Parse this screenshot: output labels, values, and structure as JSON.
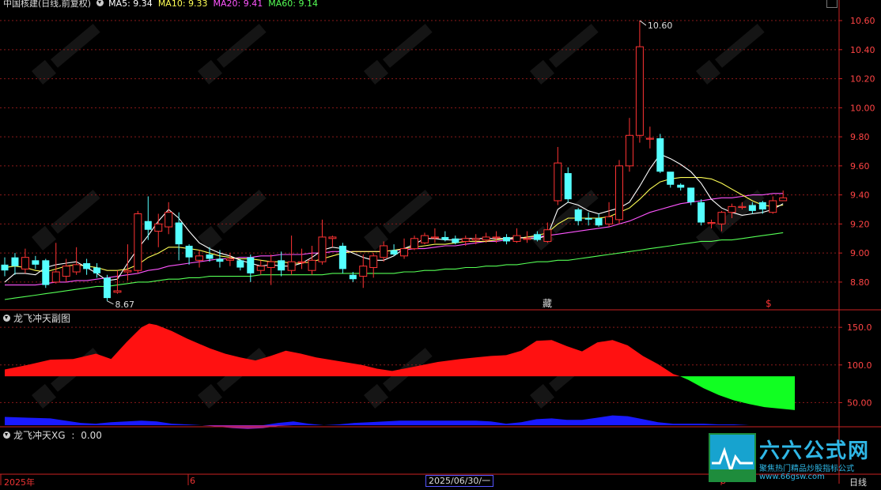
{
  "header": {
    "title": "中国核建(日线,前复权)",
    "ma": [
      {
        "label": "MA5: 9.34",
        "color": "#ffffff"
      },
      {
        "label": "MA10: 9.33",
        "color": "#ffff55"
      },
      {
        "label": "MA20: 9.41",
        "color": "#ff55ff"
      },
      {
        "label": "MA60: 9.14",
        "color": "#55ff55"
      }
    ]
  },
  "chart_data": [
    {
      "type": "candlestick",
      "yticks": [
        "10.60",
        "10.40",
        "10.20",
        "10.00",
        "9.80",
        "9.60",
        "9.40",
        "9.20",
        "9.00",
        "8.80"
      ],
      "ylim": [
        8.62,
        10.72
      ],
      "annotations": {
        "high_label": "10.60",
        "low_label": "8.67",
        "marker_cang": "藏",
        "marker_s": "$"
      },
      "colors": {
        "up": "#ff3333",
        "down": "#55ffff",
        "ma5": "#ffffff",
        "ma10": "#ffff55",
        "ma20": "#ff55ff",
        "ma60": "#55ff55"
      },
      "candles": [
        [
          8.92,
          8.88,
          8.97,
          8.84
        ],
        [
          8.97,
          8.91,
          9.0,
          8.85
        ],
        [
          8.89,
          8.97,
          9.03,
          8.86
        ],
        [
          8.95,
          8.92,
          8.98,
          8.89
        ],
        [
          8.95,
          8.78,
          8.96,
          8.76
        ],
        [
          8.8,
          8.87,
          9.07,
          8.79
        ],
        [
          8.84,
          8.91,
          8.96,
          8.8
        ],
        [
          8.87,
          8.92,
          9.04,
          8.85
        ],
        [
          8.93,
          8.89,
          8.96,
          8.85
        ],
        [
          8.9,
          8.86,
          8.93,
          8.83
        ],
        [
          8.83,
          8.69,
          8.85,
          8.67
        ],
        [
          8.73,
          8.74,
          8.88,
          8.72
        ],
        [
          8.87,
          8.88,
          9.06,
          8.81
        ],
        [
          8.88,
          9.27,
          9.29,
          8.86
        ],
        [
          9.22,
          9.16,
          9.39,
          9.09
        ],
        [
          9.15,
          9.2,
          9.27,
          9.04
        ],
        [
          9.18,
          9.28,
          9.35,
          9.13
        ],
        [
          9.21,
          9.06,
          9.28,
          8.95
        ],
        [
          9.05,
          8.97,
          9.06,
          8.92
        ],
        [
          8.95,
          8.98,
          9.02,
          8.9
        ],
        [
          8.99,
          8.96,
          9.04,
          8.94
        ],
        [
          8.96,
          8.94,
          9.02,
          8.9
        ],
        [
          8.95,
          8.96,
          9.0,
          8.91
        ],
        [
          8.95,
          8.9,
          8.96,
          8.88
        ],
        [
          8.97,
          8.86,
          8.99,
          8.8
        ],
        [
          8.88,
          8.91,
          8.95,
          8.85
        ],
        [
          8.9,
          8.94,
          8.99,
          8.78
        ],
        [
          8.95,
          8.88,
          9.01,
          8.84
        ],
        [
          8.88,
          8.94,
          9.12,
          8.85
        ],
        [
          8.94,
          8.94,
          9.03,
          8.89
        ],
        [
          8.88,
          8.95,
          9.05,
          8.85
        ],
        [
          8.94,
          9.11,
          9.23,
          8.92
        ],
        [
          9.1,
          9.11,
          9.12,
          9.04
        ],
        [
          9.05,
          8.89,
          9.07,
          8.86
        ],
        [
          8.85,
          8.82,
          8.87,
          8.8
        ],
        [
          8.84,
          8.91,
          8.99,
          8.76
        ],
        [
          8.9,
          8.98,
          9.0,
          8.83
        ],
        [
          8.97,
          9.05,
          9.08,
          8.94
        ],
        [
          9.02,
          8.99,
          9.06,
          8.98
        ],
        [
          8.98,
          9.03,
          9.1,
          8.96
        ],
        [
          9.03,
          9.1,
          9.12,
          9.02
        ],
        [
          9.07,
          9.12,
          9.14,
          9.06
        ],
        [
          9.11,
          9.11,
          9.17,
          9.07
        ],
        [
          9.11,
          9.09,
          9.15,
          9.08
        ],
        [
          9.1,
          9.07,
          9.12,
          9.06
        ],
        [
          9.08,
          9.1,
          9.12,
          9.05
        ],
        [
          9.09,
          9.1,
          9.13,
          9.06
        ],
        [
          9.09,
          9.11,
          9.14,
          9.07
        ],
        [
          9.11,
          9.11,
          9.15,
          9.07
        ],
        [
          9.11,
          9.08,
          9.13,
          9.06
        ],
        [
          9.08,
          9.12,
          9.17,
          9.07
        ],
        [
          9.1,
          9.1,
          9.15,
          9.07
        ],
        [
          9.13,
          9.09,
          9.15,
          9.08
        ],
        [
          9.08,
          9.16,
          9.21,
          9.07
        ],
        [
          9.36,
          9.62,
          9.73,
          9.33
        ],
        [
          9.55,
          9.37,
          9.59,
          9.35
        ],
        [
          9.3,
          9.22,
          9.31,
          9.19
        ],
        [
          9.24,
          9.23,
          9.28,
          9.19
        ],
        [
          9.24,
          9.19,
          9.27,
          9.18
        ],
        [
          9.2,
          9.25,
          9.35,
          9.18
        ],
        [
          9.23,
          9.6,
          9.64,
          9.2
        ],
        [
          9.6,
          9.81,
          9.93,
          9.56
        ],
        [
          9.81,
          10.42,
          10.6,
          9.76
        ],
        [
          9.79,
          9.79,
          9.87,
          9.72
        ],
        [
          9.79,
          9.56,
          9.82,
          9.55
        ],
        [
          9.56,
          9.47,
          9.54,
          9.45
        ],
        [
          9.47,
          9.45,
          9.48,
          9.43
        ],
        [
          9.45,
          9.35,
          9.45,
          9.33
        ],
        [
          9.35,
          9.21,
          9.37,
          9.19
        ],
        [
          9.21,
          9.21,
          9.23,
          9.17
        ],
        [
          9.2,
          9.28,
          9.29,
          9.15
        ],
        [
          9.28,
          9.32,
          9.34,
          9.24
        ],
        [
          9.32,
          9.32,
          9.35,
          9.3
        ],
        [
          9.33,
          9.29,
          9.35,
          9.27
        ],
        [
          9.35,
          9.3,
          9.36,
          9.27
        ],
        [
          9.28,
          9.36,
          9.39,
          9.27
        ],
        [
          9.36,
          9.38,
          9.43,
          9.36
        ]
      ],
      "ma5": [
        8.8,
        8.86,
        8.86,
        8.85,
        8.9,
        8.92,
        8.93,
        8.94,
        8.9,
        8.86,
        8.81,
        8.82,
        8.93,
        9.03,
        9.12,
        9.22,
        9.3,
        9.24,
        9.15,
        9.07,
        9.03,
        9.0,
        8.98,
        8.95,
        8.93,
        8.91,
        8.92,
        8.91,
        8.91,
        8.93,
        8.97,
        9.02,
        9.04,
        9.03,
        9.0,
        8.97,
        8.95,
        8.95,
        8.98,
        9.03,
        9.06,
        9.1,
        9.1,
        9.09,
        9.09,
        9.1,
        9.1,
        9.1,
        9.1,
        9.1,
        9.11,
        9.1,
        9.1,
        9.12,
        9.3,
        9.35,
        9.33,
        9.29,
        9.27,
        9.29,
        9.31,
        9.35,
        9.46,
        9.58,
        9.68,
        9.65,
        9.61,
        9.56,
        9.48,
        9.37,
        9.31,
        9.28,
        9.26,
        9.27,
        9.28,
        9.3,
        9.34
      ],
      "ma10": [
        8.9,
        8.91,
        8.9,
        8.88,
        8.87,
        8.89,
        8.91,
        8.92,
        8.91,
        8.9,
        8.88,
        8.88,
        8.89,
        8.92,
        8.97,
        9.0,
        9.04,
        9.04,
        9.03,
        9.02,
        9.0,
        8.98,
        8.97,
        8.96,
        8.96,
        8.95,
        8.94,
        8.94,
        8.93,
        8.93,
        8.94,
        8.96,
        8.98,
        9.0,
        9.01,
        9.01,
        9.01,
        9.01,
        9.02,
        9.03,
        9.04,
        9.05,
        9.06,
        9.06,
        9.07,
        9.08,
        9.08,
        9.08,
        9.09,
        9.1,
        9.1,
        9.11,
        9.12,
        9.14,
        9.2,
        9.24,
        9.24,
        9.24,
        9.24,
        9.25,
        9.28,
        9.31,
        9.37,
        9.44,
        9.49,
        9.51,
        9.52,
        9.52,
        9.52,
        9.51,
        9.48,
        9.44,
        9.4,
        9.36,
        9.33,
        9.32,
        9.33
      ],
      "ma20": [
        8.78,
        8.78,
        8.78,
        8.78,
        8.79,
        8.8,
        8.8,
        8.81,
        8.81,
        8.82,
        8.83,
        8.84,
        8.85,
        8.86,
        8.88,
        8.89,
        8.91,
        8.92,
        8.93,
        8.94,
        8.95,
        8.96,
        8.96,
        8.97,
        8.97,
        8.98,
        8.98,
        8.99,
        8.99,
        8.99,
        9.0,
        9.0,
        9.01,
        9.01,
        9.01,
        9.01,
        9.01,
        9.01,
        9.02,
        9.02,
        9.03,
        9.03,
        9.04,
        9.05,
        9.05,
        9.06,
        9.07,
        9.08,
        9.08,
        9.09,
        9.1,
        9.11,
        9.11,
        9.12,
        9.13,
        9.14,
        9.15,
        9.16,
        9.17,
        9.18,
        9.2,
        9.22,
        9.25,
        9.28,
        9.3,
        9.32,
        9.34,
        9.35,
        9.36,
        9.37,
        9.38,
        9.38,
        9.39,
        9.4,
        9.4,
        9.41,
        9.41
      ],
      "ma60": [
        8.68,
        8.69,
        8.7,
        8.71,
        8.72,
        8.73,
        8.74,
        8.75,
        8.76,
        8.77,
        8.77,
        8.78,
        8.79,
        8.8,
        8.8,
        8.81,
        8.82,
        8.82,
        8.83,
        8.83,
        8.84,
        8.84,
        8.84,
        8.84,
        8.84,
        8.85,
        8.85,
        8.85,
        8.85,
        8.85,
        8.85,
        8.85,
        8.86,
        8.86,
        8.86,
        8.86,
        8.86,
        8.86,
        8.86,
        8.87,
        8.87,
        8.88,
        8.88,
        8.89,
        8.89,
        8.9,
        8.9,
        8.91,
        8.91,
        8.92,
        8.92,
        8.93,
        8.94,
        8.94,
        8.95,
        8.95,
        8.96,
        8.97,
        8.98,
        8.99,
        9.0,
        9.01,
        9.02,
        9.03,
        9.04,
        9.05,
        9.06,
        9.07,
        9.08,
        9.08,
        9.09,
        9.09,
        9.1,
        9.11,
        9.12,
        9.13,
        9.14
      ]
    },
    {
      "type": "area",
      "title": "龙飞冲天副图",
      "yticks": [
        "150.0",
        "100.0",
        "50.00"
      ],
      "ylim": [
        20,
        168
      ],
      "baseline": 85,
      "colors": {
        "red": "#ff1111",
        "green": "#11ff22",
        "blue": "#1a1aff",
        "purple": "#9922aa"
      },
      "red": [
        [
          0,
          94
        ],
        [
          3,
          100
        ],
        [
          6,
          107
        ],
        [
          9,
          108
        ],
        [
          12,
          115
        ],
        [
          14,
          108
        ],
        [
          16,
          130
        ],
        [
          18,
          150
        ],
        [
          19,
          155
        ],
        [
          20,
          153
        ],
        [
          22,
          145
        ],
        [
          24,
          135
        ],
        [
          27,
          122
        ],
        [
          29,
          115
        ],
        [
          31,
          110
        ],
        [
          33,
          106
        ],
        [
          35,
          112
        ],
        [
          37,
          119
        ],
        [
          39,
          115
        ],
        [
          41,
          110
        ],
        [
          44,
          105
        ],
        [
          47,
          100
        ],
        [
          49,
          95
        ],
        [
          51,
          92
        ],
        [
          54,
          98
        ],
        [
          57,
          104
        ],
        [
          60,
          108
        ],
        [
          62,
          110
        ],
        [
          64,
          112
        ],
        [
          66,
          113
        ],
        [
          68,
          119
        ],
        [
          70,
          132
        ],
        [
          72,
          133
        ],
        [
          74,
          125
        ],
        [
          76,
          118
        ],
        [
          78,
          130
        ],
        [
          80,
          133
        ],
        [
          82,
          126
        ],
        [
          84,
          112
        ],
        [
          86,
          101
        ],
        [
          88,
          88
        ],
        [
          88.9,
          85
        ]
      ],
      "green": [
        [
          88.9,
          85
        ],
        [
          90,
          80
        ],
        [
          92,
          69
        ],
        [
          94,
          60
        ],
        [
          96,
          53
        ],
        [
          98,
          48
        ],
        [
          100,
          44
        ],
        [
          102,
          42
        ],
        [
          104,
          40
        ]
      ],
      "blue": [
        [
          0,
          31
        ],
        [
          3,
          30
        ],
        [
          6,
          29
        ],
        [
          8,
          26
        ],
        [
          10,
          23
        ],
        [
          12,
          22
        ],
        [
          14,
          24
        ],
        [
          16,
          25
        ],
        [
          18,
          26
        ],
        [
          20,
          25
        ],
        [
          22,
          22
        ],
        [
          24,
          21
        ],
        [
          26,
          20
        ],
        [
          28,
          19
        ],
        [
          30,
          19
        ],
        [
          32,
          19
        ],
        [
          34,
          20
        ],
        [
          36,
          23
        ],
        [
          38,
          25
        ],
        [
          40,
          22
        ],
        [
          42,
          20
        ],
        [
          44,
          21
        ],
        [
          46,
          23
        ],
        [
          48,
          24
        ],
        [
          50,
          25
        ],
        [
          52,
          26
        ],
        [
          54,
          26
        ],
        [
          56,
          26
        ],
        [
          58,
          26
        ],
        [
          60,
          26
        ],
        [
          62,
          26
        ],
        [
          64,
          25
        ],
        [
          66,
          22
        ],
        [
          68,
          24
        ],
        [
          70,
          28
        ],
        [
          72,
          29
        ],
        [
          74,
          27
        ],
        [
          76,
          27
        ],
        [
          78,
          30
        ],
        [
          80,
          33
        ],
        [
          82,
          32
        ],
        [
          84,
          28
        ],
        [
          86,
          24
        ],
        [
          88,
          22
        ],
        [
          90,
          22
        ],
        [
          92,
          22
        ],
        [
          94,
          21
        ],
        [
          96,
          21
        ],
        [
          98,
          20
        ],
        [
          100,
          20
        ],
        [
          104,
          20
        ]
      ],
      "purple": [
        [
          26,
          20
        ],
        [
          28,
          18
        ],
        [
          30,
          16
        ],
        [
          32,
          15
        ],
        [
          34,
          16
        ],
        [
          36,
          19
        ],
        [
          38,
          20
        ]
      ]
    }
  ],
  "pane3": {
    "title": "龙飞冲天XG",
    "value": "0.00"
  },
  "footer": {
    "year": "2025年",
    "month6": "6",
    "date_box": "2025/06/30/一",
    "month8": "8",
    "period": "日线"
  },
  "logo": {
    "title": "六六公式网",
    "slogan": "聚焦热门精品炒股指标公式",
    "url": "www.66gsw.com"
  }
}
